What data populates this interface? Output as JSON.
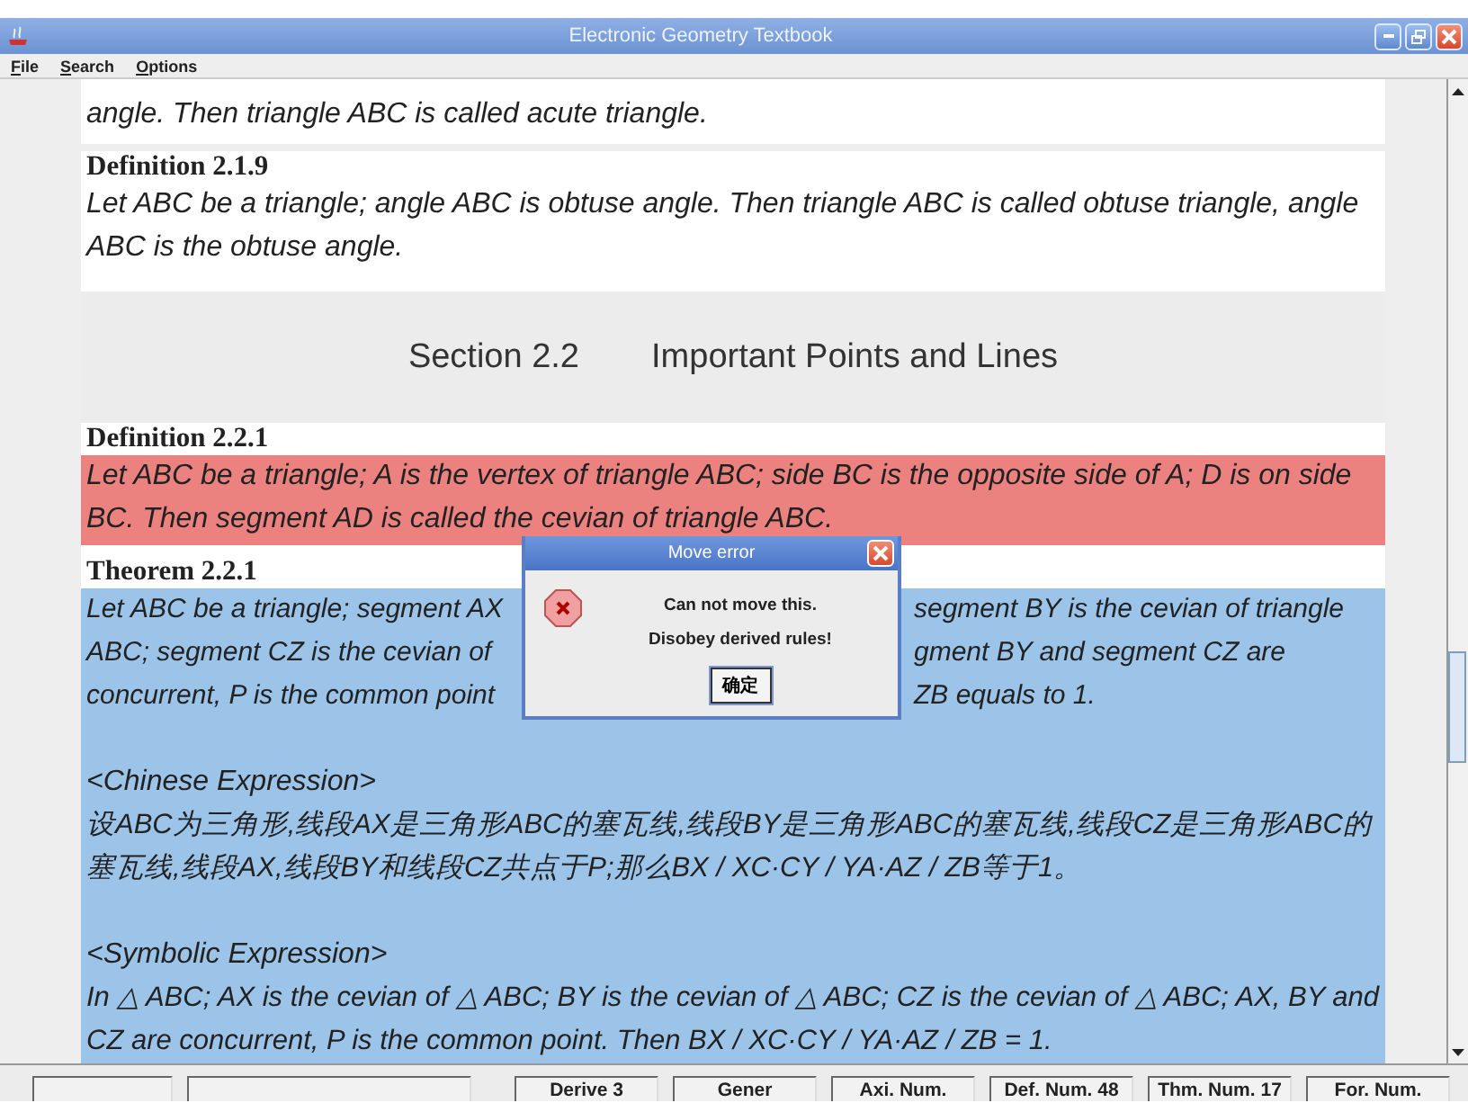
{
  "window": {
    "title": "Electronic Geometry Textbook"
  },
  "menu": [
    {
      "label": "File",
      "mnemonic_underlined": true
    },
    {
      "label": "Search",
      "mnemonic_underlined": true
    },
    {
      "label": "Options",
      "mnemonic_underlined": true
    }
  ],
  "content": {
    "blocks": [
      {
        "kind": "text",
        "body": "angle. Then triangle ABC is called acute triangle."
      },
      {
        "kind": "definition",
        "heading": "Definition 2.1.9",
        "body": "Let ABC be a triangle; angle ABC is obtuse angle. Then triangle ABC is called obtuse triangle, angle ABC is the obtuse angle."
      },
      {
        "kind": "section",
        "number": "Section 2.2",
        "title": "Important Points and Lines"
      },
      {
        "kind": "definition",
        "color": "#ec8280",
        "heading": "Definition 2.2.1",
        "body": "Let ABC be a triangle; A is the vertex of triangle ABC; side BC is the opposite side of A; D is on side BC. Then segment AD is called the cevian of triangle ABC."
      },
      {
        "kind": "theorem",
        "color": "#9cc3e8",
        "heading": "Theorem 2.2.1",
        "lines": [
          [
            "Let ABC be a triangle; segment AX",
            "segment BY is the cevian of triangle"
          ],
          [
            "ABC; segment CZ is the cevian of",
            "gment BY and segment CZ are"
          ],
          [
            "concurrent, P is the common point",
            "ZB equals to 1."
          ]
        ],
        "expressions": [
          {
            "label": "<Chinese Expression>",
            "text": "设ABC为三角形,线段AX是三角形ABC的塞瓦线,线段BY是三角形ABC的塞瓦线,线段CZ是三角形ABC的塞瓦线,线段AX,线段BY和线段CZ共点于P;那么BX / XC·CY / YA·AZ / ZB等于1。"
          },
          {
            "label": "<Symbolic Expression>",
            "text": "In △ ABC; AX is the cevian of △ ABC; BY is the cevian of △ ABC; CZ is the cevian of △ ABC; AX, BY and CZ are concurrent, P is the common point. Then BX / XC·CY / YA·AZ / ZB = 1."
          }
        ]
      }
    ]
  },
  "dialog": {
    "title": "Move error",
    "messages": [
      "Can not move this.",
      "Disobey derived rules!"
    ],
    "button": "确定"
  },
  "status_bar": [
    "Derive 3",
    "Gener",
    "Axi. Num.",
    "Def. Num. 48",
    "Thm. Num. 17",
    "For. Num."
  ]
}
